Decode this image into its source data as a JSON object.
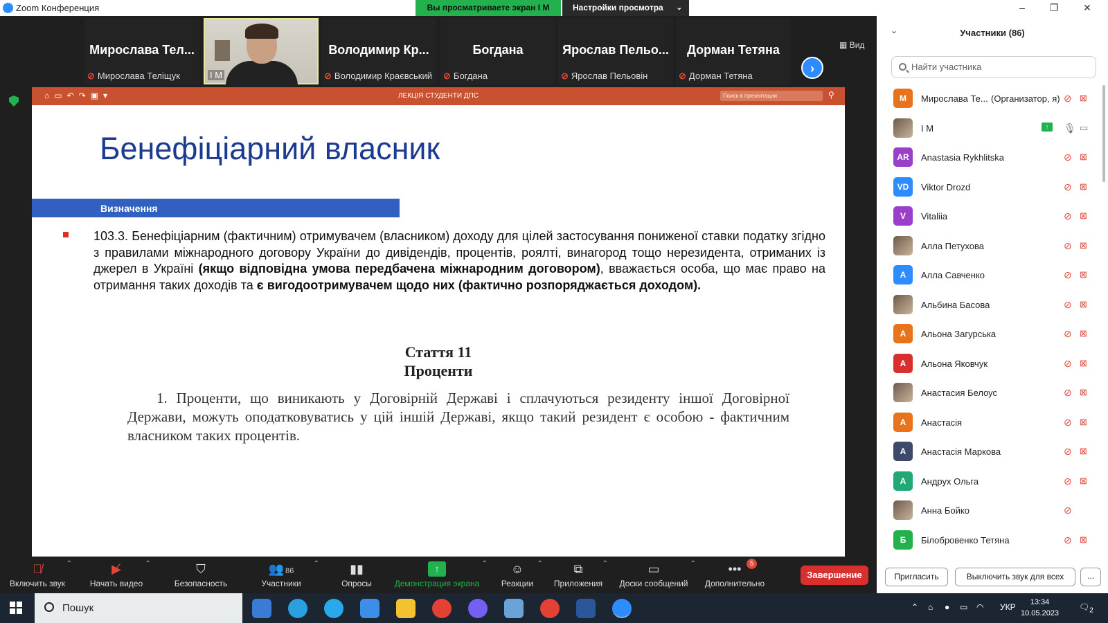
{
  "window": {
    "title": "Zoom Конференция",
    "share_banner": "Вы просматриваете экран I M",
    "view_settings": "Настройки просмотра",
    "view_label": "Вид"
  },
  "video_strip": {
    "tiles": [
      {
        "display": "Мирослава Тел...",
        "label": "Мирослава Теліщук"
      },
      {
        "display": "",
        "label": "I M"
      },
      {
        "display": "Володимир Кр...",
        "label": "Володимир Краєвський"
      },
      {
        "display": "Богдана",
        "label": "Богдана"
      },
      {
        "display": "Ярослав Пельо...",
        "label": "Ярослав Пельовін"
      },
      {
        "display": "Дорман Тетяна",
        "label": "Дорман Тетяна"
      }
    ]
  },
  "presentation": {
    "file_title": "ЛЕКЦІЯ СТУДЕНТИ ДПС",
    "search_placeholder": "Поиск в презентации",
    "slide_title": "Бенефіціарний власник",
    "section_label": "Визначення",
    "paragraph": {
      "p1": "103.3. Бенефіціарним (фактичним) отримувачем (власником) доходу для цілей застосування пониженої ставки податку згідно з правилами міжнародного договору України до дивідендів, процентів, роялті, винагород тощо нерезидента, отриманих із джерел в Україні ",
      "p2": "(якщо відповідна умова передбачена міжнародним договором)",
      "p3": ", вважається особа, що має право на отримання таких доходів та ",
      "p4": "є вигодоотримувачем щодо них (фактично розпоряджається доходом)."
    },
    "article_number": "Стаття 11",
    "article_name": "Проценти",
    "article_text": "1. Проценти, що виникають у Договірній Державі і сплачуються резиденту іншої Договірної Держави, можуть оподатковуватись у цій іншій Державі, якщо такий резидент є особою - фактичним власником таких процентів."
  },
  "participants_panel": {
    "title": "Участники (86)",
    "search_placeholder": "Найти участника",
    "participants": [
      {
        "initials": "M",
        "name": "Мирослава Те...",
        "role": "(Организатор, я)",
        "color": "#e8731a"
      },
      {
        "initials": "",
        "name": "I M",
        "role": "",
        "color": "#555",
        "sharing": true
      },
      {
        "initials": "AR",
        "name": "Anastasia Rykhlitska",
        "role": "",
        "color": "#9a3fc9"
      },
      {
        "initials": "VD",
        "name": "Viktor Drozd",
        "role": "",
        "color": "#2d8cff"
      },
      {
        "initials": "V",
        "name": "Vitaliia",
        "role": "",
        "color": "#9a3fc9"
      },
      {
        "initials": "",
        "name": "Алла Петухова",
        "role": "",
        "color": "#444"
      },
      {
        "initials": "A",
        "name": "Алла Савченко",
        "role": "",
        "color": "#2d8cff"
      },
      {
        "initials": "",
        "name": "Альбина Басова",
        "role": "",
        "color": "#c9a35a"
      },
      {
        "initials": "A",
        "name": "Альона Загурська",
        "role": "",
        "color": "#e8731a"
      },
      {
        "initials": "A",
        "name": "Альона Яковчук",
        "role": "",
        "color": "#d8302f"
      },
      {
        "initials": "",
        "name": "Анастасия Белоус",
        "role": "",
        "color": "#7a4a40"
      },
      {
        "initials": "A",
        "name": "Анастасія",
        "role": "",
        "color": "#e8731a"
      },
      {
        "initials": "A",
        "name": "Анастасія Маркова",
        "role": "",
        "color": "#3d4a6a"
      },
      {
        "initials": "A",
        "name": "Андрух Ольга",
        "role": "",
        "color": "#22a874"
      },
      {
        "initials": "",
        "name": "Анна Бойко",
        "role": "",
        "color": "#5a7a40"
      },
      {
        "initials": "Б",
        "name": "Білобровенко Тетяна",
        "role": "",
        "color": "#22b14c"
      }
    ],
    "invite_label": "Пригласить",
    "mute_all_label": "Выключить звук для всех",
    "more_label": "..."
  },
  "toolbar": {
    "unmute": "Включить звук",
    "start_video": "Начать видео",
    "security": "Безопасность",
    "participants": "Участники",
    "participants_count": "86",
    "polls": "Опросы",
    "share_screen": "Демонстрация экрана",
    "reactions": "Реакции",
    "apps": "Приложения",
    "whiteboards": "Доски сообщений",
    "more": "Дополнительно",
    "more_badge": "5",
    "end": "Завершение"
  },
  "taskbar": {
    "search_label": "Пошук",
    "language": "УКР",
    "time": "13:34",
    "date": "10.05.2023",
    "notif_count": "2"
  }
}
